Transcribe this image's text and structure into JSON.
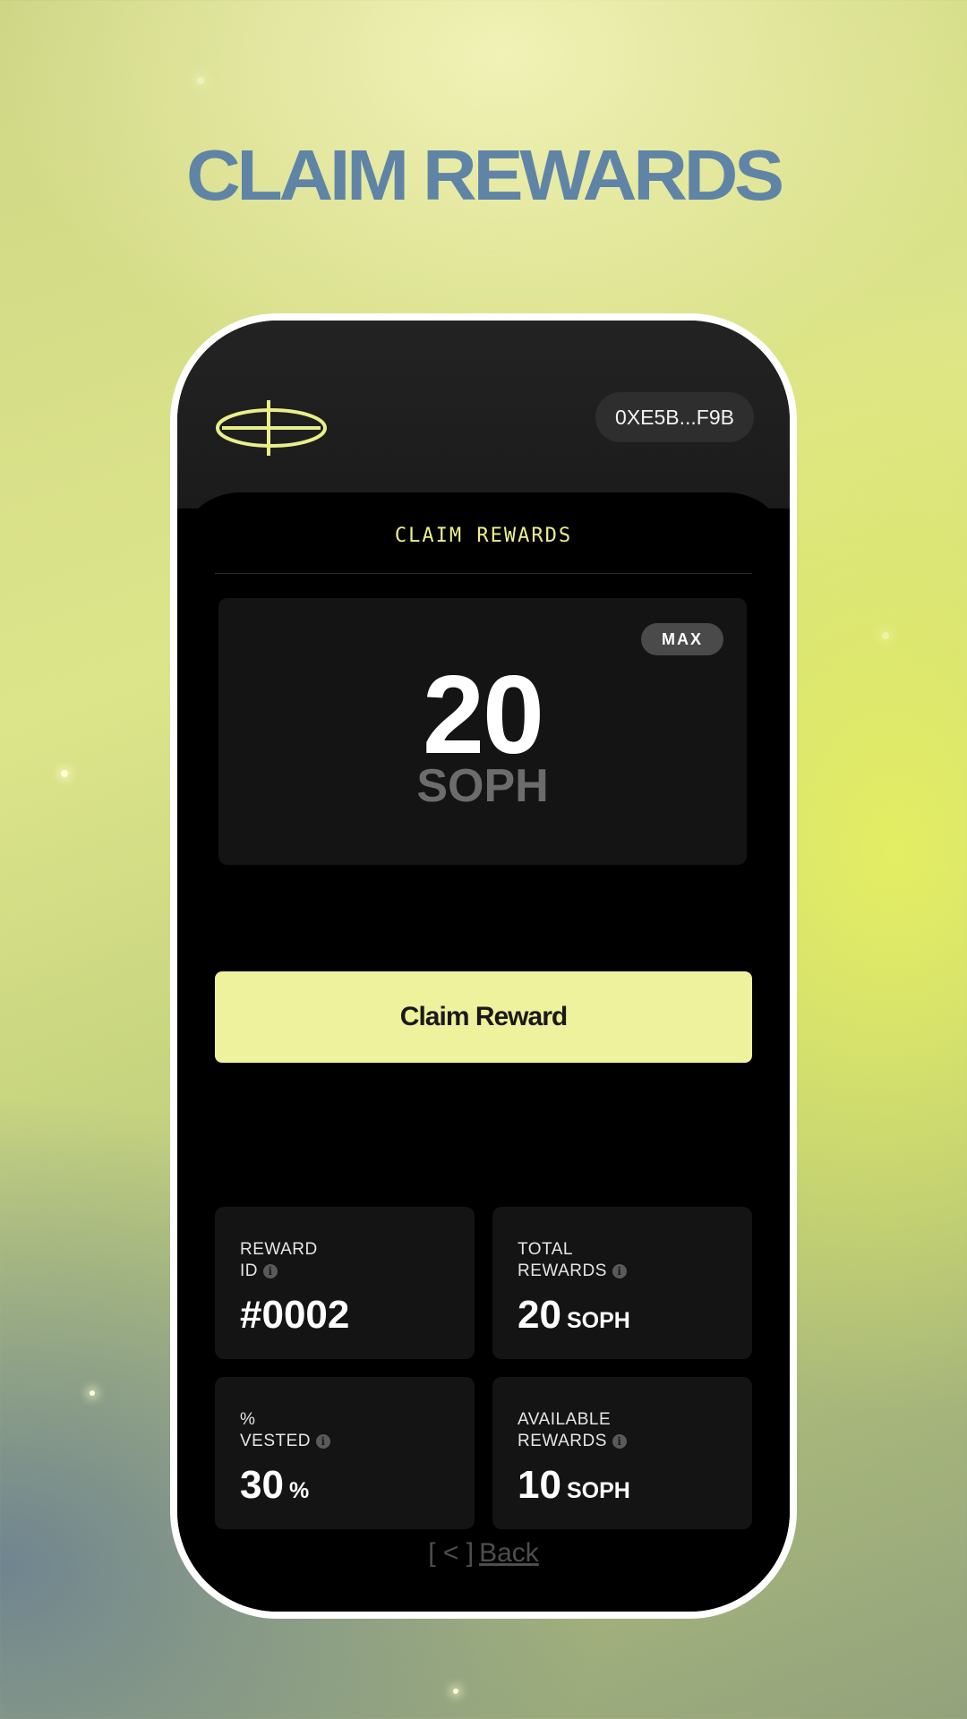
{
  "page": {
    "title": "CLAIM REWARDS"
  },
  "header": {
    "wallet_address": "0XE5B...F9B",
    "logo_icon": "eye-logo-icon"
  },
  "claim": {
    "section_title": "CLAIM REWARDS",
    "max_label": "MAX",
    "amount": "20",
    "unit": "SOPH",
    "button_label": "Claim Reward"
  },
  "stats": {
    "reward_id": {
      "label_line1": "REWARD",
      "label_line2": "ID",
      "value": "#0002",
      "unit": ""
    },
    "total_rewards": {
      "label_line1": "TOTAL",
      "label_line2": "REWARDS",
      "value": "20",
      "unit": "SOPH"
    },
    "vested": {
      "label_line1": "%",
      "label_line2": "VESTED",
      "value": "30",
      "unit": "%"
    },
    "available": {
      "label_line1": "AVAILABLE",
      "label_line2": "REWARDS",
      "value": "10",
      "unit": "SOPH"
    }
  },
  "footer": {
    "back_bracket": "[ < ]",
    "back_label": "Back"
  },
  "colors": {
    "accent": "#eef29c",
    "title": "#5f84a6",
    "card": "#141414"
  }
}
